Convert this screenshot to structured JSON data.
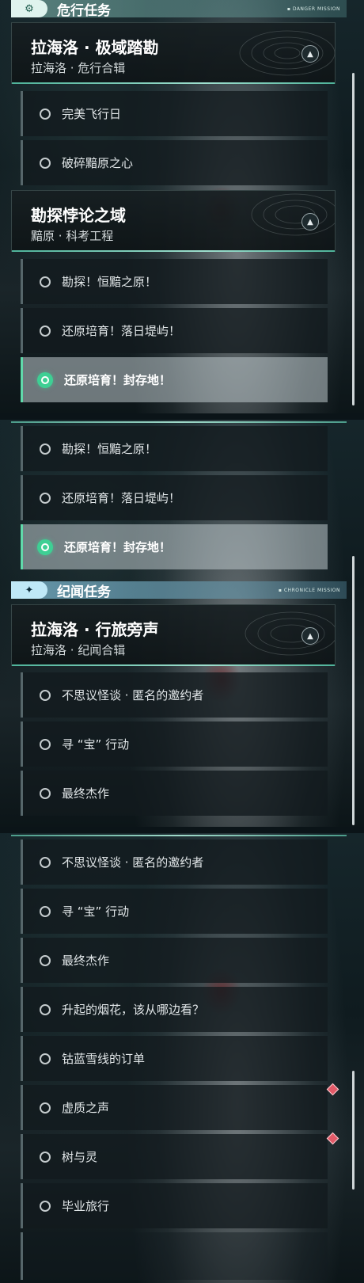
{
  "panels": [
    {
      "section": {
        "title": "危行任务",
        "subtitle": "▪ DANGER MISSION"
      },
      "groups": [
        {
          "title": "拉海洛 · 极域踏勘",
          "subtitle": "拉海洛 · 危行合辑",
          "tasks": [
            "完美飞行日",
            "破碎黯原之心"
          ]
        },
        {
          "title": "勘探悖论之域",
          "subtitle": "黯原 · 科考工程",
          "tasks": [
            "勘探！恒黯之原！",
            "还原培育！落日堤屿！",
            "还原培育！封存地！"
          ]
        }
      ]
    },
    {
      "tasks": [
        "勘探！恒黯之原！",
        "还原培育！落日堤屿！",
        "还原培育！封存地！"
      ],
      "section": {
        "title": "纪闻任务",
        "subtitle": "▪ CHRONICLE MISSION"
      },
      "group": {
        "title": "拉海洛 · 行旅旁声",
        "subtitle": "拉海洛 · 纪闻合辑",
        "tasks": [
          "不思议怪谈 · 匿名的邀约者",
          "寻 “宝” 行动",
          "最终杰作"
        ]
      }
    },
    {
      "tasks": [
        "不思议怪谈 · 匿名的邀约者",
        "寻 “宝” 行动",
        "最终杰作",
        "升起的烟花，该从哪边看？",
        "钴蓝雪线的订单",
        "虚质之声",
        "树与灵",
        "毕业旅行"
      ]
    }
  ],
  "colors": {
    "accent": "#3ecf94",
    "alert": "#e25a68",
    "header_band": "#8cc8be"
  },
  "icons": {
    "danger_section": "gear-icon",
    "chronicle_section": "star-icon",
    "active_task": "target-icon",
    "collapse": "chevron-up-icon"
  }
}
